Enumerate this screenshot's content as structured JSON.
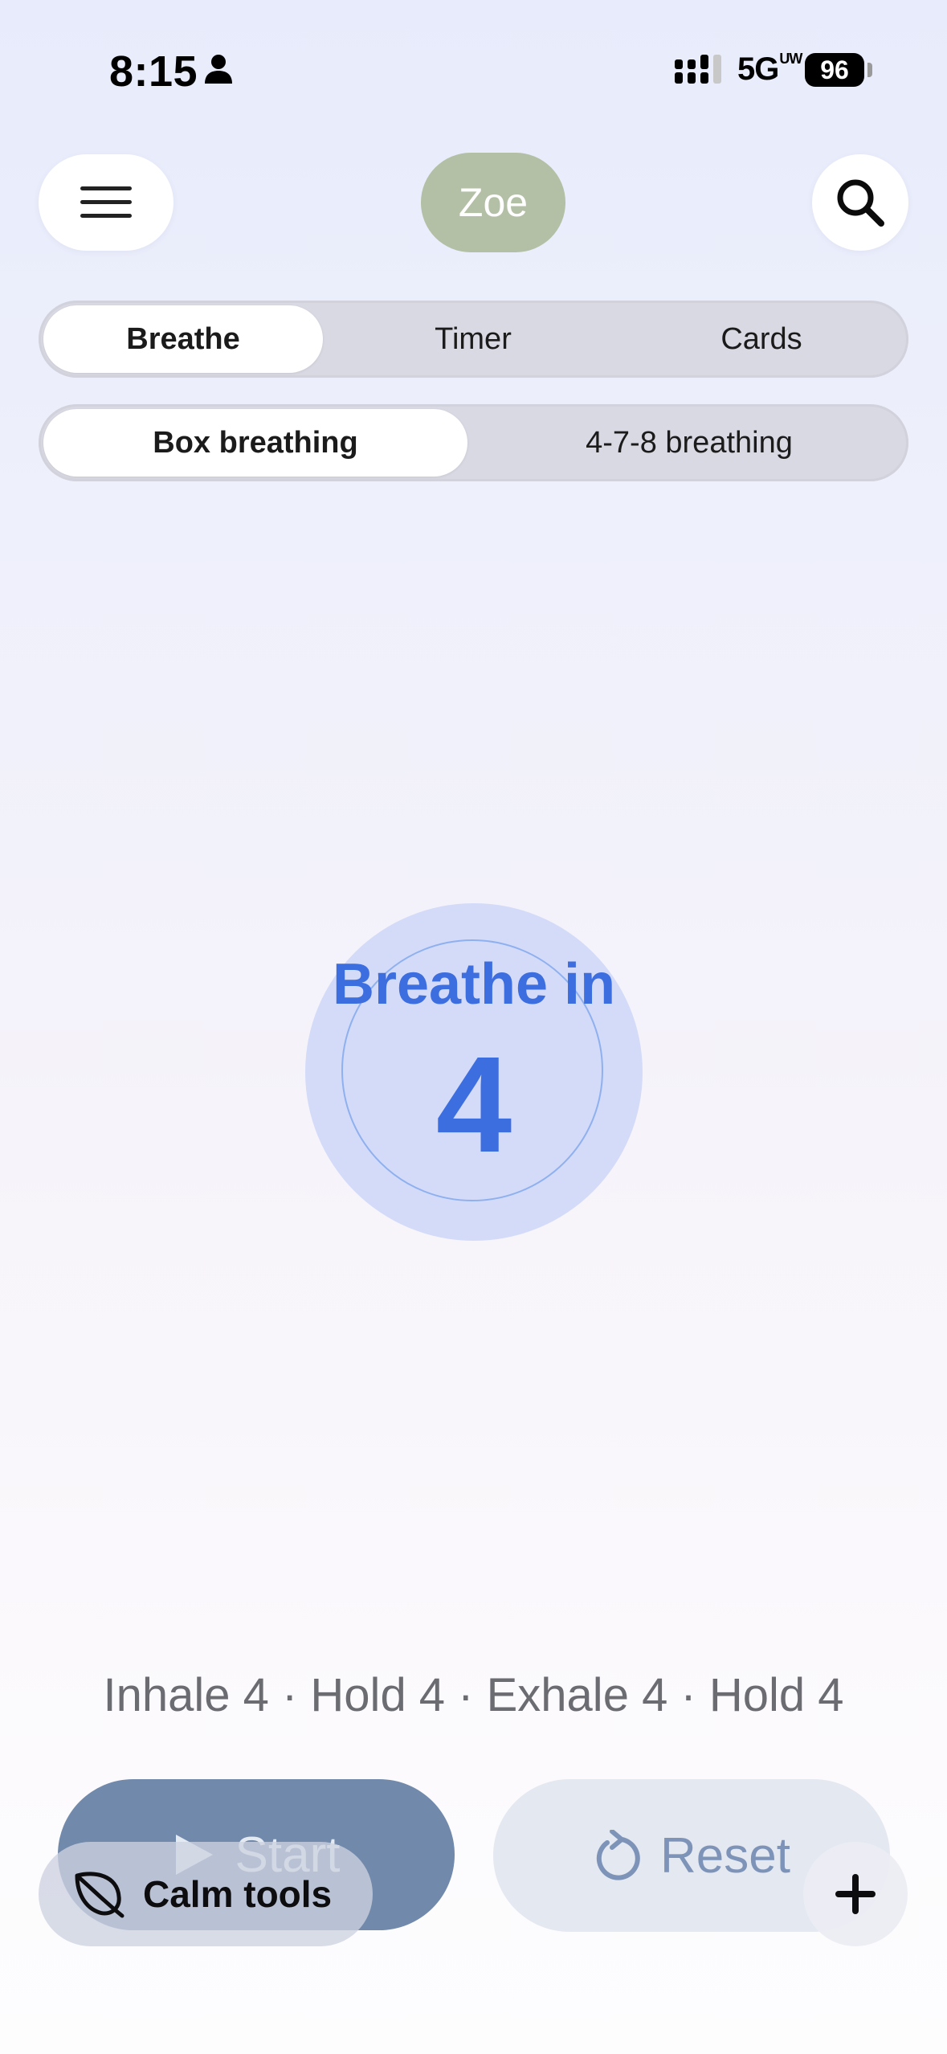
{
  "status_bar": {
    "time": "8:15",
    "network": "5G",
    "network_sup": "UW",
    "battery": "96"
  },
  "header": {
    "menu_icon": "hamburger-menu-icon",
    "avatar_label": "Zoe",
    "search_icon": "search-icon"
  },
  "tabs": [
    {
      "label": "Breathe",
      "active": true
    },
    {
      "label": "Timer",
      "active": false
    },
    {
      "label": "Cards",
      "active": false
    }
  ],
  "modes": [
    {
      "label": "Box breathing",
      "active": true
    },
    {
      "label": "4-7-8 breathing",
      "active": false
    }
  ],
  "breathing": {
    "phase": "Breathe in",
    "count": "4",
    "pattern": "Inhale 4 · Hold 4 · Exhale 4 · Hold 4"
  },
  "controls": {
    "start_label": "Start",
    "start_icon": "play-icon",
    "reset_label": "Reset",
    "reset_icon": "reset-icon"
  },
  "calm_tools": {
    "label": "Calm tools",
    "icon": "leaf-icon"
  },
  "fab": {
    "icon": "plus-icon"
  },
  "colors": {
    "accent": "#3d6ee0",
    "circle": "#d3dbf8",
    "start_button": "#7189aa",
    "avatar": "#b3c0a6"
  }
}
